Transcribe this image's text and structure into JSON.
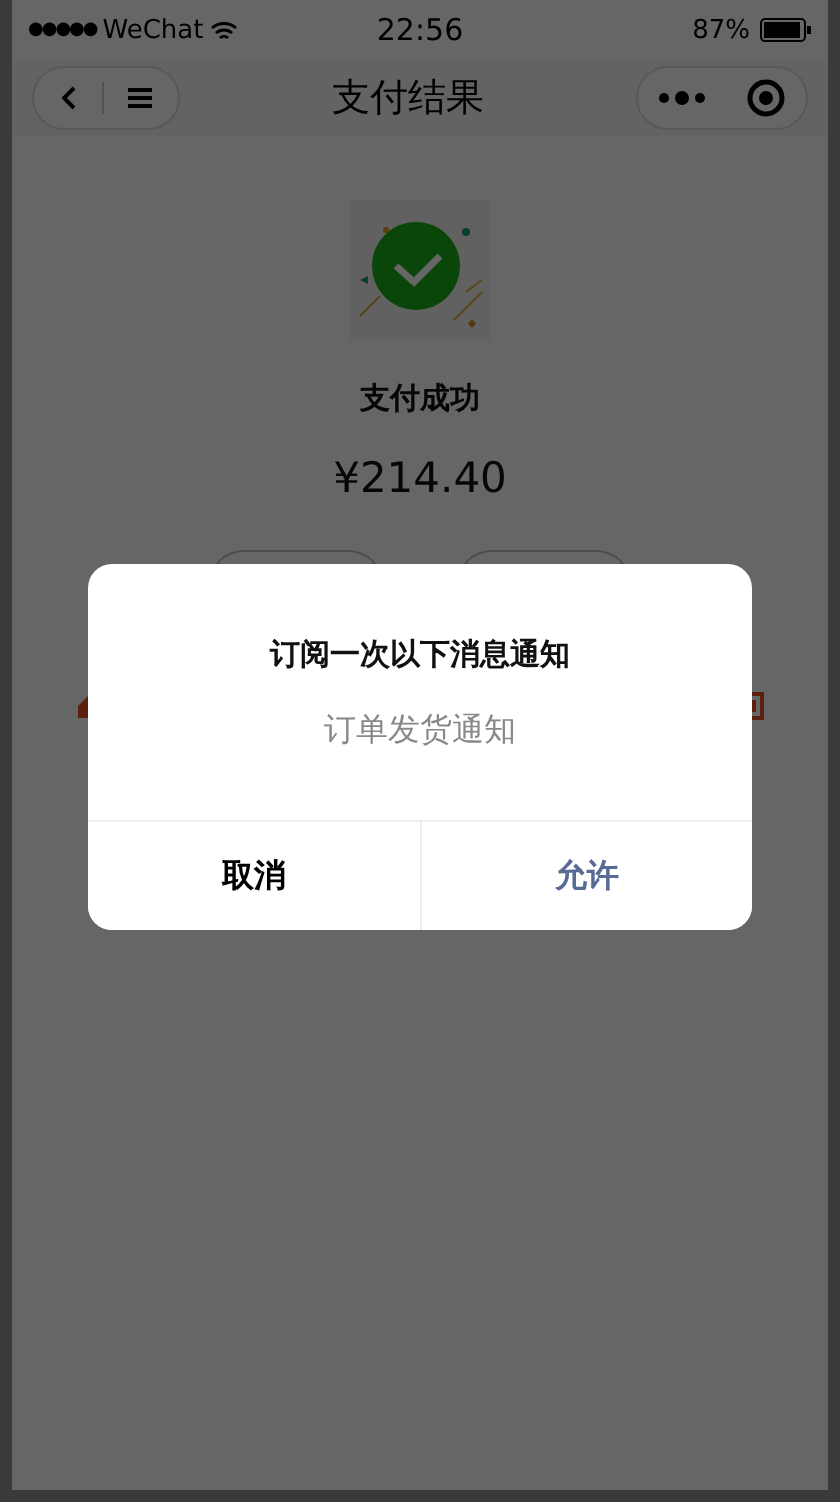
{
  "status_bar": {
    "signal": "●●●●●",
    "carrier": "WeChat",
    "time": "22:56",
    "battery": "87%"
  },
  "nav": {
    "title": "支付结果"
  },
  "result": {
    "title": "支付成功",
    "amount": "¥214.40"
  },
  "dialog": {
    "title": "订阅一次以下消息通知",
    "item": "订单发货通知",
    "buttons": [
      {
        "label": "取消",
        "kind": "cancel"
      },
      {
        "label": "允许",
        "kind": "confirm"
      }
    ]
  }
}
